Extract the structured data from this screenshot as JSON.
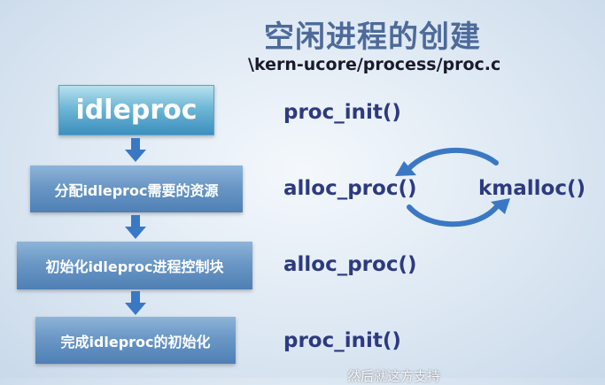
{
  "slide": {
    "title": "空闲进程的创建",
    "file_path": "\\kern-ucore/process/proc.c",
    "steps": [
      {
        "box_label": "idleproc",
        "code_label": "proc_init()"
      },
      {
        "box_label": "分配idleproc需要的资源",
        "code_label": "alloc_proc()"
      },
      {
        "box_label": "初始化idleproc进程控制块",
        "code_label": "alloc_proc()"
      },
      {
        "box_label": "完成idleproc的初始化",
        "code_label": "proc_init()"
      }
    ],
    "cycle_partner": "kmalloc()",
    "subtitle": "然后就这方支持"
  },
  "colors": {
    "title": "#4d6a9a",
    "code": "#2d3a80",
    "box_fill": "#6a97c6",
    "box_top_fill": "#6fb7d6",
    "arrow": "#3a78c4"
  }
}
